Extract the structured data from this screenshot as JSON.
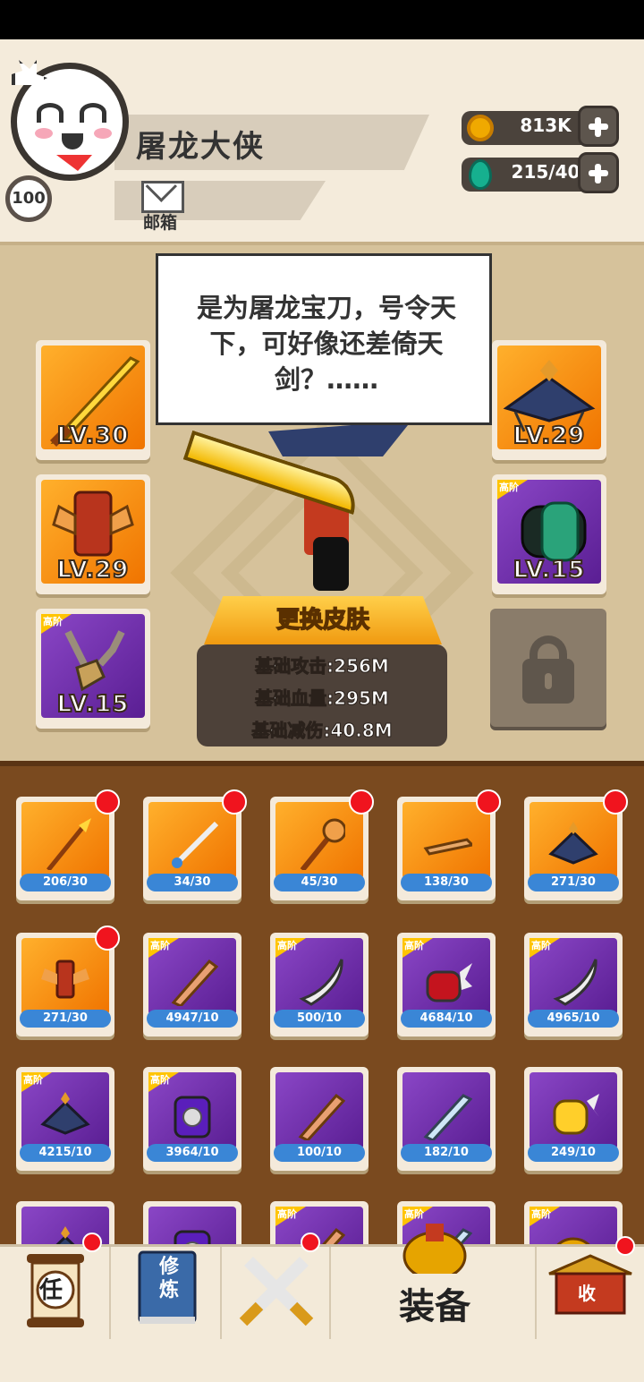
{
  "player": {
    "name": "屠龙大侠",
    "level": "100",
    "mail_label": "邮箱"
  },
  "resources": {
    "gold": "813K",
    "gems": "215/40"
  },
  "speech": "是为屠龙宝刀，号令天下，可好像还差倚天剑？……",
  "equip_slots": [
    {
      "level": "LV.30",
      "rarity": "orange",
      "icon": "golden-sword-icon"
    },
    {
      "level": "LV.29",
      "rarity": "orange",
      "icon": "armor-icon"
    },
    {
      "level": "LV.15",
      "rarity": "purple",
      "tag": "高阶",
      "icon": "amulet-icon"
    },
    {
      "level": "LV.29",
      "rarity": "orange",
      "icon": "straw-hat-icon"
    },
    {
      "level": "LV.15",
      "rarity": "purple",
      "tag": "高阶",
      "icon": "bracer-icon"
    }
  ],
  "skin_button": "更换皮肤",
  "stats": {
    "attack": "基础攻击:256M",
    "hp": "基础血量:295M",
    "reduce": "基础减伤:40.8M"
  },
  "items": [
    {
      "count": "206/30",
      "rarity": "orange",
      "dot": true,
      "icon": "spear-icon"
    },
    {
      "count": "34/30",
      "rarity": "orange",
      "dot": true,
      "icon": "sword-icon"
    },
    {
      "count": "45/30",
      "rarity": "orange",
      "dot": true,
      "icon": "staff-icon"
    },
    {
      "count": "138/30",
      "rarity": "orange",
      "dot": true,
      "icon": "broken-blade-icon"
    },
    {
      "count": "271/30",
      "rarity": "orange",
      "dot": true,
      "icon": "straw-hat-icon"
    },
    {
      "count": "271/30",
      "rarity": "orange",
      "dot": true,
      "icon": "armor-icon"
    },
    {
      "count": "4947/10",
      "rarity": "purple",
      "tag": "高阶",
      "icon": "wooden-sword-icon"
    },
    {
      "count": "500/10",
      "rarity": "purple",
      "tag": "高阶",
      "icon": "saber-icon"
    },
    {
      "count": "4684/10",
      "rarity": "purple",
      "tag": "高阶",
      "icon": "spiked-gauntlet-icon"
    },
    {
      "count": "4965/10",
      "rarity": "purple",
      "tag": "高阶",
      "icon": "saber-icon"
    },
    {
      "count": "4215/10",
      "rarity": "purple",
      "tag": "高阶",
      "icon": "straw-hat-icon"
    },
    {
      "count": "3964/10",
      "rarity": "purple",
      "tag": "高阶",
      "icon": "chest-armor-icon"
    },
    {
      "count": "100/10",
      "rarity": "purple",
      "tag": "",
      "icon": "wooden-sword-icon"
    },
    {
      "count": "182/10",
      "rarity": "purple",
      "tag": "",
      "icon": "crystal-sword-icon"
    },
    {
      "count": "249/10",
      "rarity": "purple",
      "tag": "",
      "icon": "golden-gauntlet-icon"
    },
    {
      "count": "",
      "rarity": "purple",
      "tag": "",
      "icon": "straw-hat-icon"
    },
    {
      "count": "",
      "rarity": "purple",
      "tag": "",
      "icon": "chest-armor-icon"
    },
    {
      "count": "",
      "rarity": "purple",
      "tag": "高阶",
      "icon": "wooden-sword-icon"
    },
    {
      "count": "",
      "rarity": "purple",
      "tag": "高阶",
      "icon": "crystal-sword-icon"
    },
    {
      "count": "",
      "rarity": "purple",
      "tag": "高阶",
      "icon": "helmet-icon"
    }
  ],
  "nav": {
    "task_label": "任",
    "cultivate_label": "修炼",
    "equip_label": "装备",
    "shop_label": "收"
  },
  "colors": {
    "orange_rarity": "#f07400",
    "purple_rarity": "#5a1e93",
    "count_bar": "#3a86d6",
    "notification_dot": "#f0141e"
  }
}
